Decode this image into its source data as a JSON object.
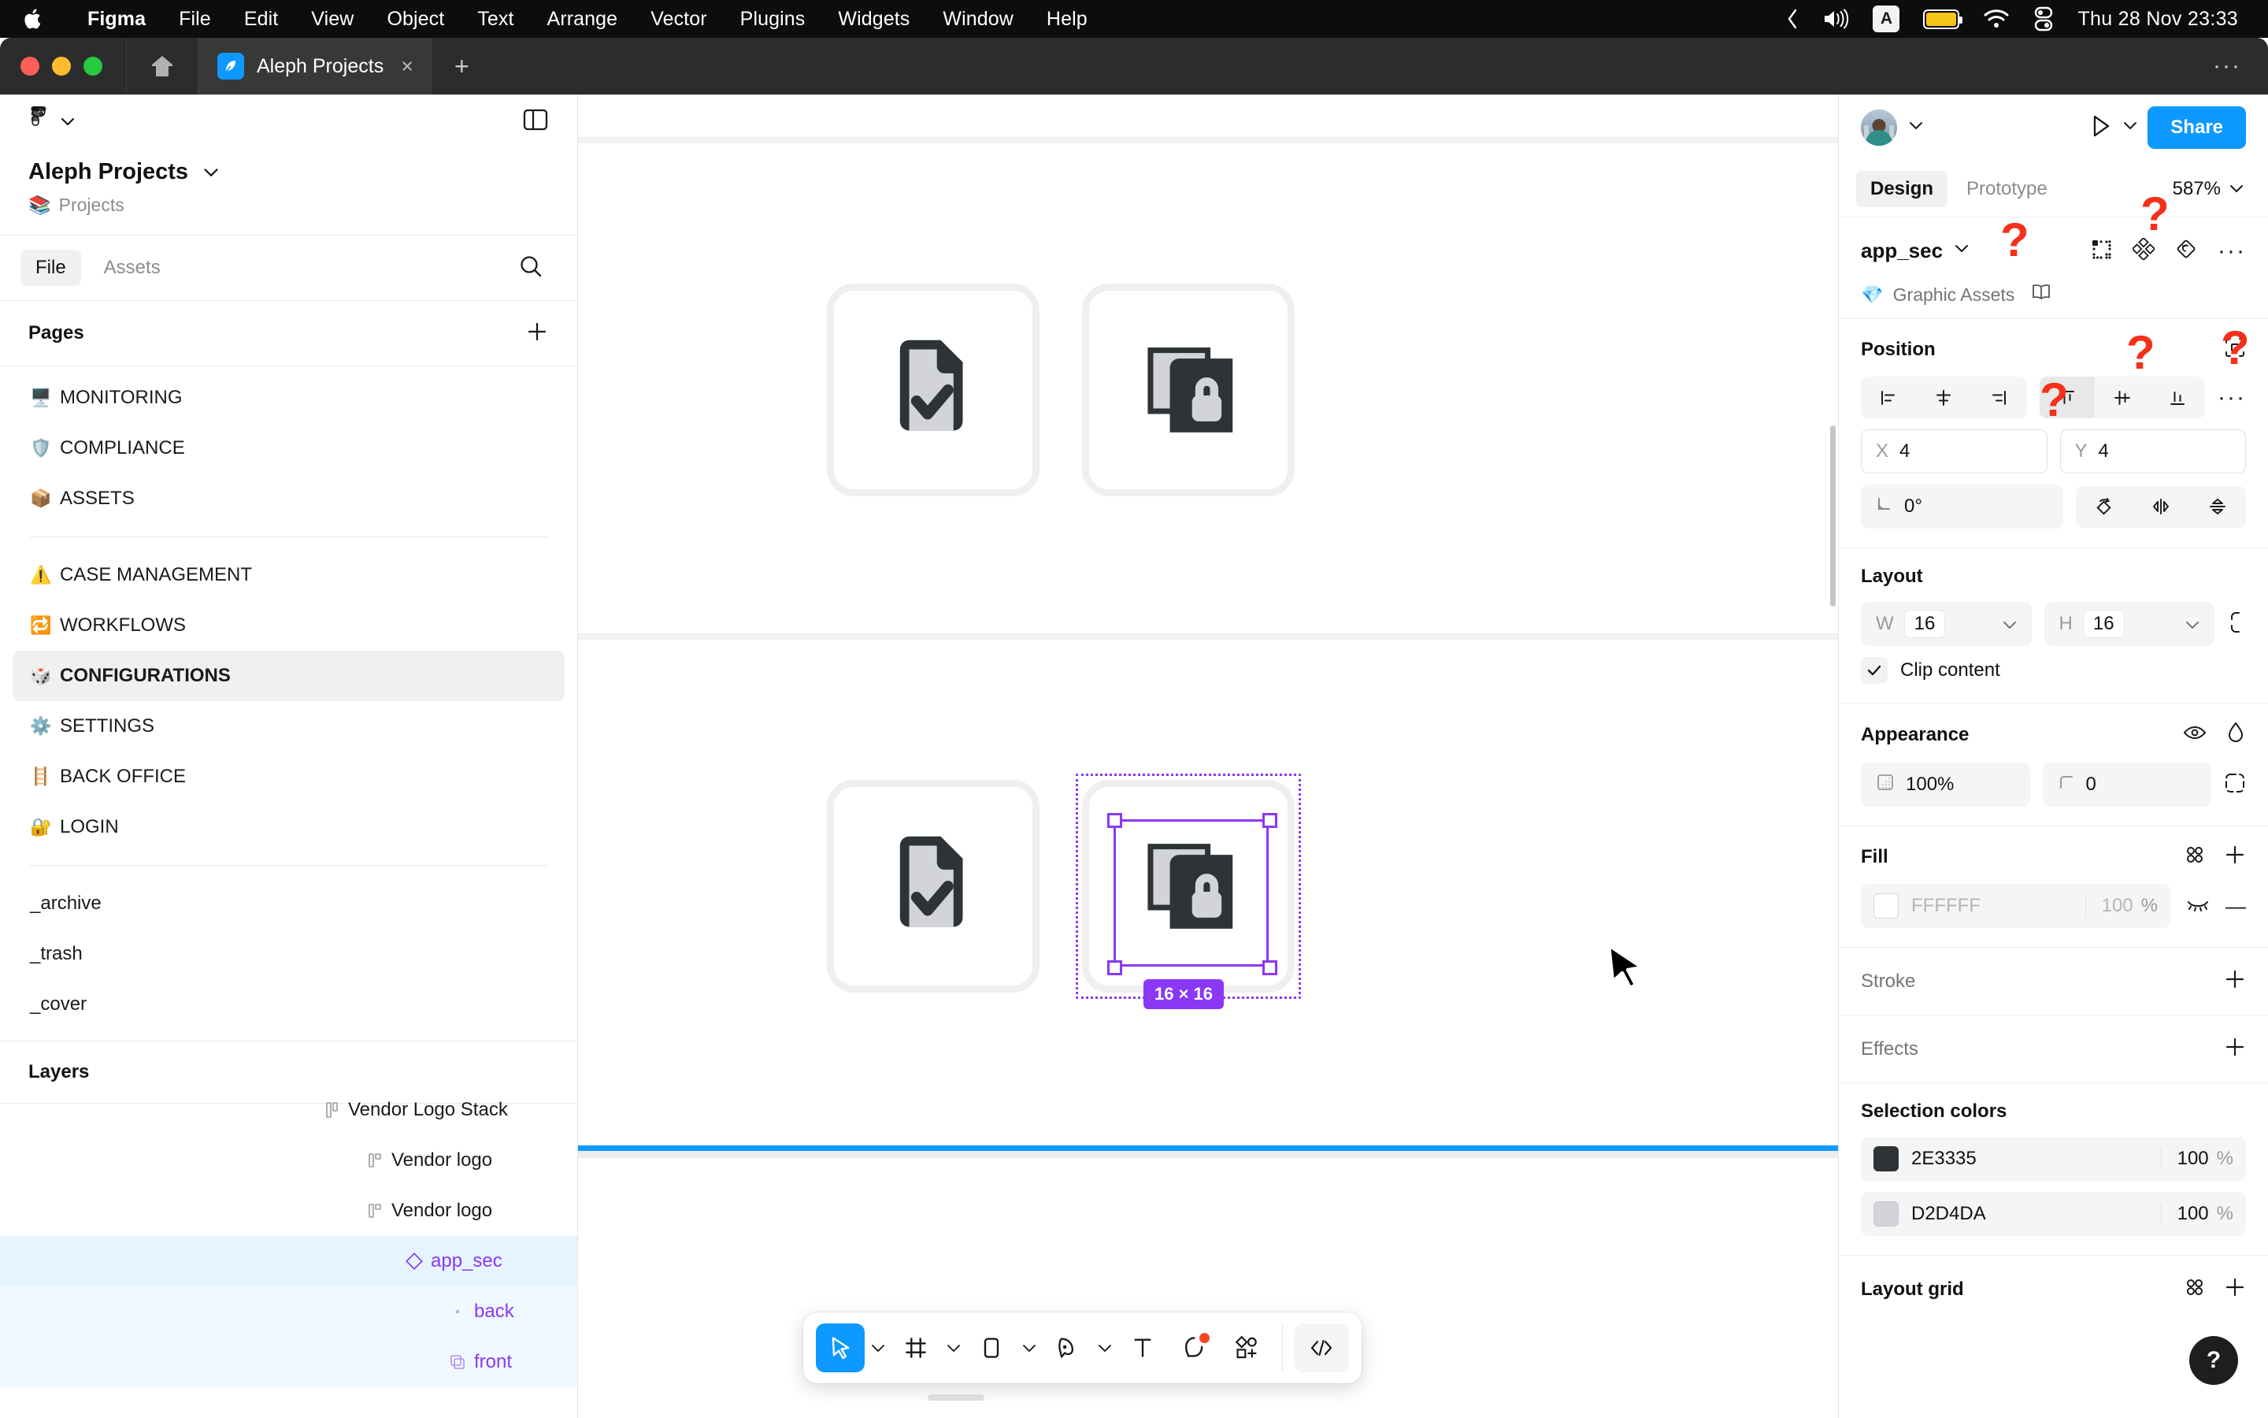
{
  "menubar": {
    "apple_icon": "apple-logo",
    "items": [
      "Figma",
      "File",
      "Edit",
      "View",
      "Object",
      "Text",
      "Arrange",
      "Vector",
      "Plugins",
      "Widgets",
      "Window",
      "Help"
    ],
    "status_icons": [
      "chevron-left-icon",
      "volume-icon",
      "input-source-badge",
      "battery-icon",
      "wifi-icon",
      "control-center-icon"
    ],
    "input_source": "A",
    "clock": "Thu 28 Nov  23:33"
  },
  "tabbar": {
    "home_label": "home-icon",
    "tab_title": "Aleph Projects",
    "close_label": "×",
    "new_tab_label": "+",
    "window_more_label": "···"
  },
  "left_panel": {
    "file_title": "Aleph Projects",
    "breadcrumb_emoji": "📚",
    "breadcrumb": "Projects",
    "tabs": [
      {
        "label": "File",
        "active": true
      },
      {
        "label": "Assets",
        "active": false
      }
    ],
    "pages_title": "Pages",
    "add_page_label": "+",
    "pages": [
      {
        "emoji": "🖥️",
        "label": "MONITORING",
        "active": false
      },
      {
        "emoji": "🛡️",
        "label": "COMPLIANCE",
        "active": false
      },
      {
        "emoji": "📦",
        "label": "ASSETS",
        "active": false
      },
      {
        "emoji": "⚠️",
        "label": "CASE MANAGEMENT",
        "active": false
      },
      {
        "emoji": "🔁",
        "label": "WORKFLOWS",
        "active": false
      },
      {
        "emoji": "🎲",
        "label": "CONFIGURATIONS",
        "active": true
      },
      {
        "emoji": "⚙️",
        "label": "SETTINGS",
        "active": false
      },
      {
        "emoji": "🪜",
        "label": "BACK OFFICE",
        "active": false
      },
      {
        "emoji": "🔐",
        "label": "LOGIN",
        "active": false
      }
    ],
    "pages_extra": [
      "_archive",
      "_trash",
      "_cover"
    ],
    "layers_title": "Layers",
    "layers": [
      {
        "label": "Vendor Logo Stack",
        "indent": 0,
        "selected": false,
        "purple": false,
        "icon": "frame-icon"
      },
      {
        "label": "Vendor logo",
        "indent": 1,
        "selected": false,
        "purple": false,
        "icon": "component-instance-icon"
      },
      {
        "label": "Vendor logo",
        "indent": 1,
        "selected": false,
        "purple": false,
        "icon": "component-instance-icon"
      },
      {
        "label": "app_sec",
        "indent": 2,
        "selected": true,
        "purple": true,
        "icon": "component-diamond-icon"
      },
      {
        "label": "back",
        "indent": 3,
        "selected": false,
        "purple": true,
        "icon": "vector-icon"
      },
      {
        "label": "front",
        "indent": 3,
        "selected": false,
        "purple": true,
        "icon": "vector-icon"
      }
    ]
  },
  "canvas": {
    "selection_size_badge": "16 × 16",
    "icons": [
      {
        "name": "document-check-icon",
        "row": "top"
      },
      {
        "name": "app-security-lock-icon",
        "row": "top"
      },
      {
        "name": "document-check-icon",
        "row": "bottom"
      },
      {
        "name": "app-security-lock-icon",
        "row": "bottom",
        "selected": true
      }
    ],
    "colors": {
      "icon_dark": "#2E3335",
      "icon_light": "#D2D4DA",
      "selection_purple": "#8A38F5",
      "divider_blue": "#0D99FF"
    }
  },
  "toolbar": {
    "tools": [
      {
        "name": "move-tool",
        "active": true,
        "caret": true
      },
      {
        "name": "frame-tool",
        "active": false,
        "caret": true
      },
      {
        "name": "shape-tool",
        "active": false,
        "caret": true
      },
      {
        "name": "pen-tool",
        "active": false,
        "caret": true
      },
      {
        "name": "text-tool",
        "active": false,
        "caret": false
      },
      {
        "name": "comment-tool",
        "active": false,
        "caret": false
      },
      {
        "name": "actions-tool",
        "active": false,
        "caret": false
      }
    ],
    "dev_mode_label": "</>"
  },
  "right_panel": {
    "play_label": "play-icon",
    "share_label": "Share",
    "tabs": [
      {
        "label": "Design",
        "active": true
      },
      {
        "label": "Prototype",
        "active": false
      }
    ],
    "zoom": "587%",
    "selection_name": "app_sec",
    "selection_icons": [
      "create-component-icon",
      "component-set-icon",
      "detach-instance-icon",
      "more-options-icon"
    ],
    "library_emoji": "💎",
    "library_name": "Graphic Assets",
    "library_icon": "book-icon",
    "position": {
      "title": "Position",
      "align_h": [
        "align-left-icon",
        "align-center-h-icon",
        "align-right-icon"
      ],
      "align_v": [
        "align-top-icon",
        "align-center-v-icon",
        "align-bottom-icon"
      ],
      "more_label": "···",
      "x_label": "X",
      "x_value": "4",
      "y_label": "Y",
      "y_value": "4",
      "rotation_value": "0°",
      "transform_icons": [
        "rotate-icon",
        "flip-horizontal-icon",
        "flip-vertical-icon"
      ],
      "absolute_position_icon": "absolute-position-icon"
    },
    "layout": {
      "title": "Layout",
      "w_label": "W",
      "w_value": "16",
      "h_label": "H",
      "h_value": "16",
      "constrain_icon": "constrain-proportions-icon",
      "clip_content_label": "Clip content",
      "clip_content_checked": true
    },
    "appearance": {
      "title": "Appearance",
      "visible_icon": "eye-icon",
      "blend_icon": "blend-mode-icon",
      "opacity_value": "100%",
      "corner_radius_value": "0",
      "independent_corners_icon": "independent-corners-icon"
    },
    "fill": {
      "title": "Fill",
      "styles_icon": "styles-icon",
      "add_label": "+",
      "hex": "FFFFFF",
      "opacity": "100",
      "unit": "%",
      "hidden_icon": "eye-closed-icon",
      "remove_label": "—"
    },
    "stroke": {
      "title": "Stroke",
      "add_label": "+"
    },
    "effects": {
      "title": "Effects",
      "add_label": "+"
    },
    "selection_colors": {
      "title": "Selection colors",
      "rows": [
        {
          "hex": "2E3335",
          "swatch": "#2E3335",
          "opacity": "100",
          "unit": "%"
        },
        {
          "hex": "D2D4DA",
          "swatch": "#D2D4DA",
          "opacity": "100",
          "unit": "%"
        }
      ]
    },
    "layout_grid": {
      "title": "Layout grid",
      "styles_icon": "styles-icon",
      "add_label": "+"
    },
    "help_label": "?"
  },
  "annotations": {
    "question_marks": [
      "?",
      "?",
      "?",
      "?",
      "?"
    ]
  }
}
